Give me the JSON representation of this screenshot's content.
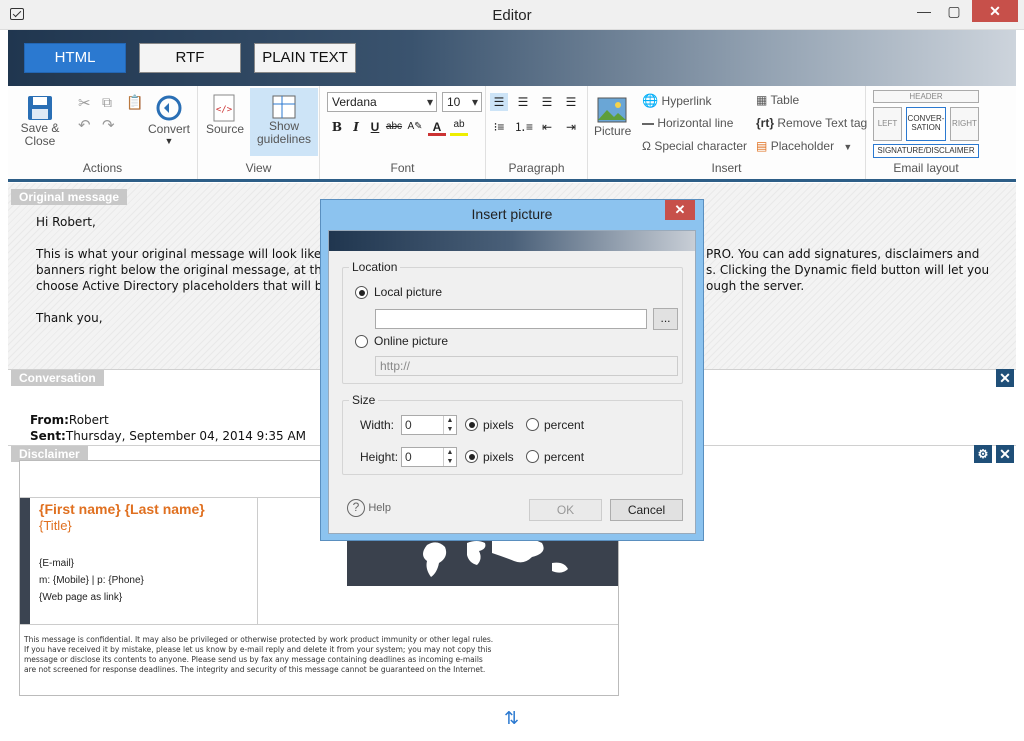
{
  "window": {
    "title": "Editor"
  },
  "format_tabs": [
    "HTML",
    "RTF",
    "PLAIN TEXT"
  ],
  "ribbon": {
    "actions": {
      "save_close": "Save &\nClose",
      "convert": "Convert",
      "label": "Actions"
    },
    "view": {
      "source": "Source",
      "show_guidelines": "Show\nguidelines",
      "label": "View"
    },
    "font": {
      "family": "Verdana",
      "size": "10",
      "label": "Font"
    },
    "paragraph": {
      "label": "Paragraph"
    },
    "insert": {
      "picture": "Picture",
      "hyperlink": "Hyperlink",
      "horizontal_line": "Horizontal line",
      "special_character": "Special character",
      "table": "Table",
      "remove_text_tag": "Remove Text tag",
      "placeholder": "Placeholder",
      "label": "Insert"
    },
    "email_layout": {
      "header": "HEADER",
      "left": "LEFT",
      "conversation": "CONVER-\nSATION",
      "right": "RIGHT",
      "signature": "SIGNATURE/DISCLAIMER",
      "label": "Email layout"
    }
  },
  "sections": {
    "original": "Original message",
    "conversation": "Conversation",
    "disclaimer": "Disclaimer"
  },
  "original_message": {
    "greeting": "Hi Robert,",
    "line1_left": "This is what your original message will look like to",
    "line1_right": "PRO. You can add signatures, disclaimers and",
    "line2_left": "banners right below the original message, at the v",
    "line2_right": "s. Clicking the Dynamic field button will let you",
    "line3_left": "choose Active Directory placeholders that will be",
    "line3_right": "ough the server.",
    "closing": "Thank you,"
  },
  "conversation": {
    "from_label": "From:",
    "from_value": "Robert",
    "sent_label": "Sent:",
    "sent_value": "Thursday, September 04, 2014 9:35 AM"
  },
  "signature": {
    "name": "{First name} {Last name}",
    "title": "{Title}",
    "email": "{E-mail}",
    "phone": "m:  {Mobile} | p: {Phone}",
    "web": "{Web page as link}",
    "disclaimer": "This message is confidential. It may also be privileged or otherwise protected by work product immunity or other legal rules. If you have received it by mistake, please let us know by e-mail reply and delete it from your system; you may not copy this message or disclose its contents to anyone. Please send us by fax any message containing deadlines as incoming e-mails are not screened for response deadlines. The integrity and security of this message cannot be guaranteed on the Internet."
  },
  "dialog": {
    "title": "Insert picture",
    "location_legend": "Location",
    "local_picture": "Local picture",
    "local_path": "",
    "browse": "...",
    "online_picture": "Online picture",
    "online_url": "http://",
    "size_legend": "Size",
    "width_label": "Width:",
    "width_value": "0",
    "height_label": "Height:",
    "height_value": "0",
    "pixels": "pixels",
    "percent": "percent",
    "help": "Help",
    "ok": "OK",
    "cancel": "Cancel"
  },
  "colors": {
    "accent": "#2b79d0",
    "dark_band": "#20364f",
    "signature_name": "#e07020"
  }
}
